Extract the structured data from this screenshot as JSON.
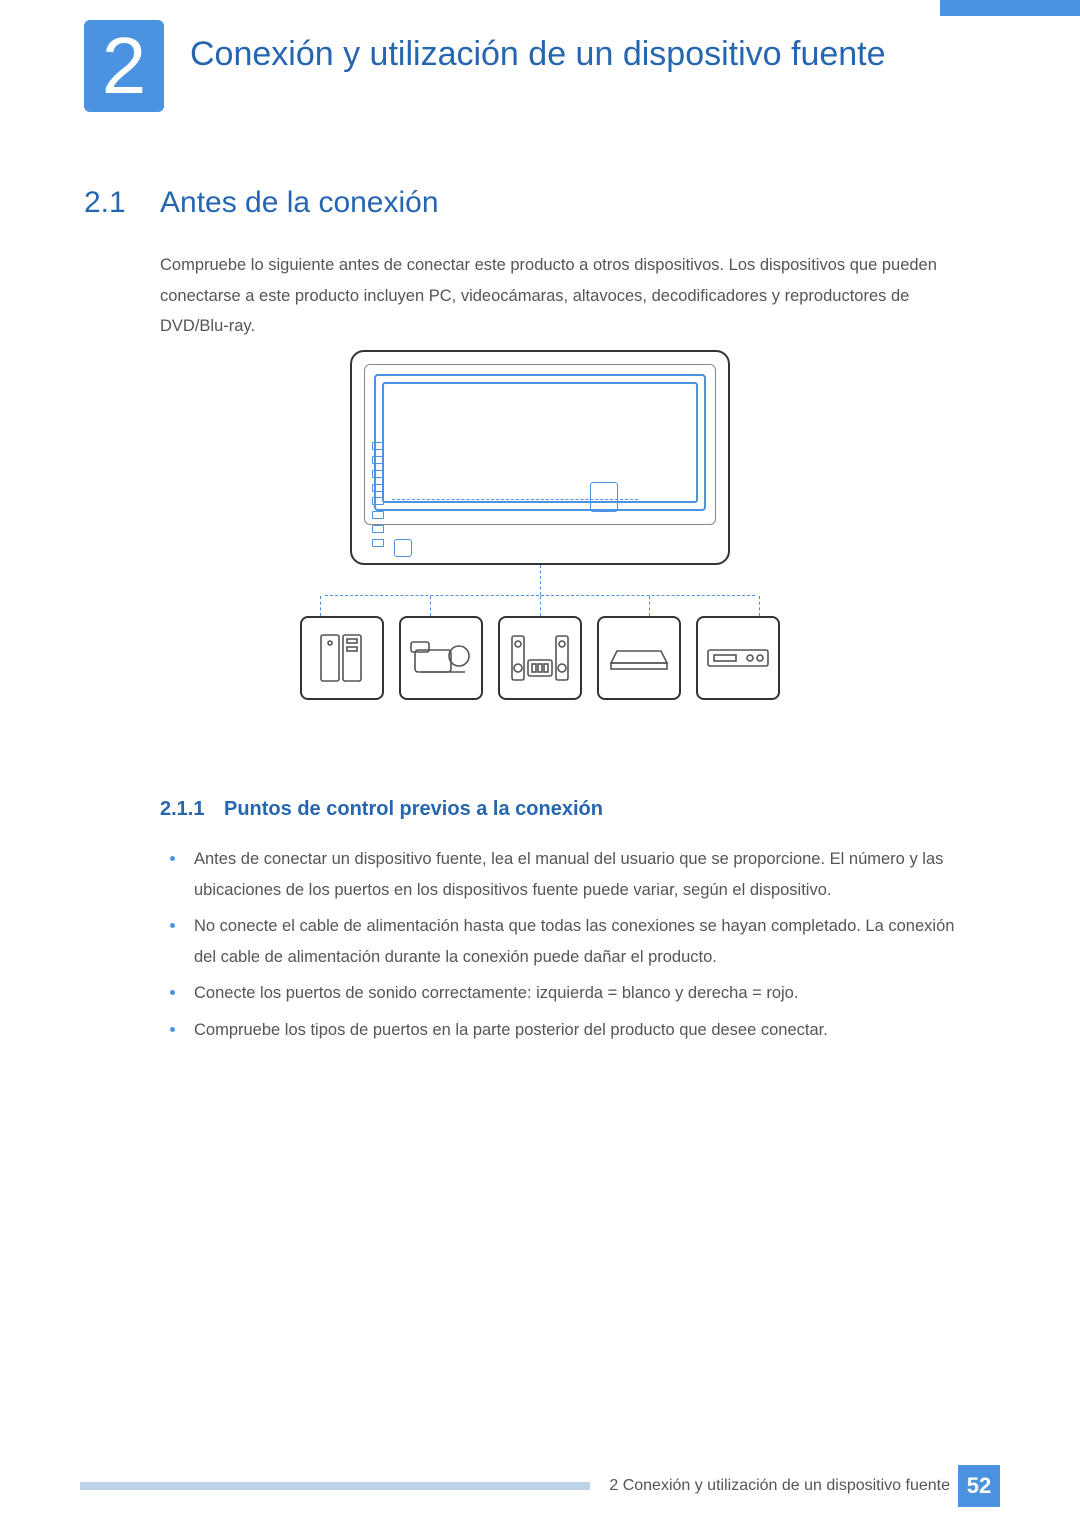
{
  "chapter": {
    "number": "2",
    "title": "Conexión y utilización de un dispositivo fuente"
  },
  "section": {
    "number": "2.1",
    "title": "Antes de la conexión",
    "intro": "Compruebe lo siguiente antes de conectar este producto a otros dispositivos. Los dispositivos que pueden conectarse a este producto incluyen PC, videocámaras, altavoces, decodificadores y reproductores de DVD/Blu-ray."
  },
  "subsection": {
    "number": "2.1.1",
    "title": "Puntos de control previos a la conexión",
    "bullets": [
      "Antes de conectar un dispositivo fuente, lea el manual del usuario que se proporcione. El número y las ubicaciones de los puertos en los dispositivos fuente puede variar, según el dispositivo.",
      "No conecte el cable de alimentación hasta que todas las conexiones se hayan completado. La conexión del cable de alimentación durante la conexión puede dañar el producto.",
      "Conecte los puertos de sonido correctamente: izquierda = blanco y derecha = rojo.",
      "Compruebe los tipos de puertos en la parte posterior del producto que desee conectar."
    ]
  },
  "devices": [
    "desktop-pc",
    "camcorder",
    "speakers",
    "decoder",
    "dvd-player"
  ],
  "footer": {
    "text": "2 Conexión y utilización de un dispositivo fuente",
    "page": "52"
  },
  "colors": {
    "accent": "#4b92e0",
    "heading": "#2666b0"
  }
}
